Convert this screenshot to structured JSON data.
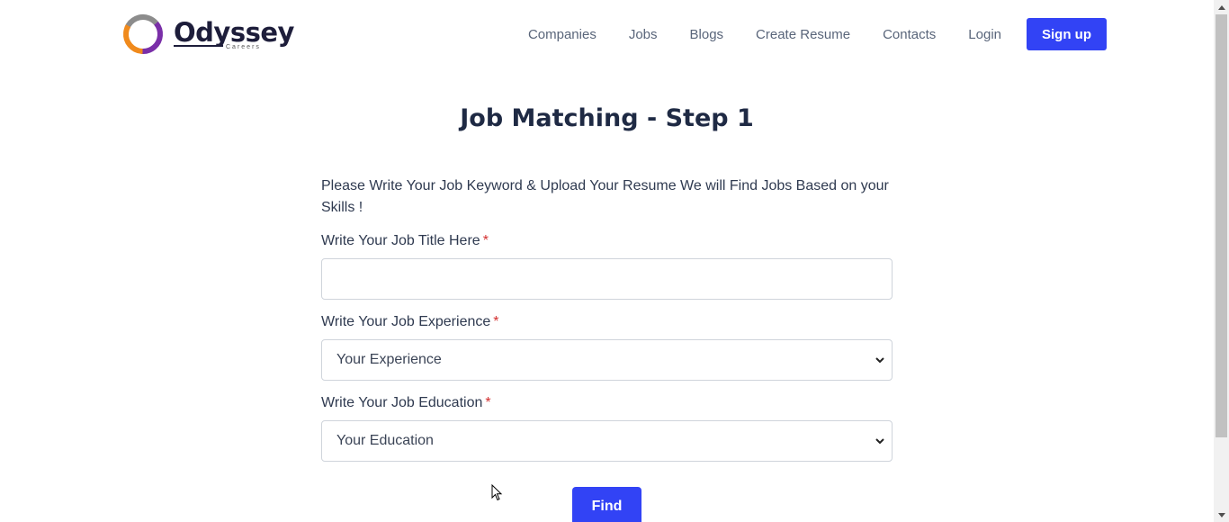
{
  "brand": {
    "name": "Odyssey",
    "tagline": "Careers"
  },
  "nav": {
    "items": [
      "Companies",
      "Jobs",
      "Blogs",
      "Create Resume",
      "Contacts",
      "Login"
    ],
    "signup": "Sign up"
  },
  "page": {
    "title": "Job Matching - Step 1",
    "intro": "Please Write Your Job Keyword & Upload Your Resume We will Find Jobs Based on your Skills !"
  },
  "form": {
    "title_label": "Write Your Job Title Here",
    "title_value": "",
    "experience_label": "Write Your Job Experience",
    "experience_selected": "Your Experience",
    "education_label": "Write Your Job Education",
    "education_selected": "Your Education",
    "required_mark": "*",
    "submit": "Find"
  },
  "colors": {
    "accent": "#3243f5",
    "heading": "#1f2a44",
    "required": "#d32f2f"
  }
}
